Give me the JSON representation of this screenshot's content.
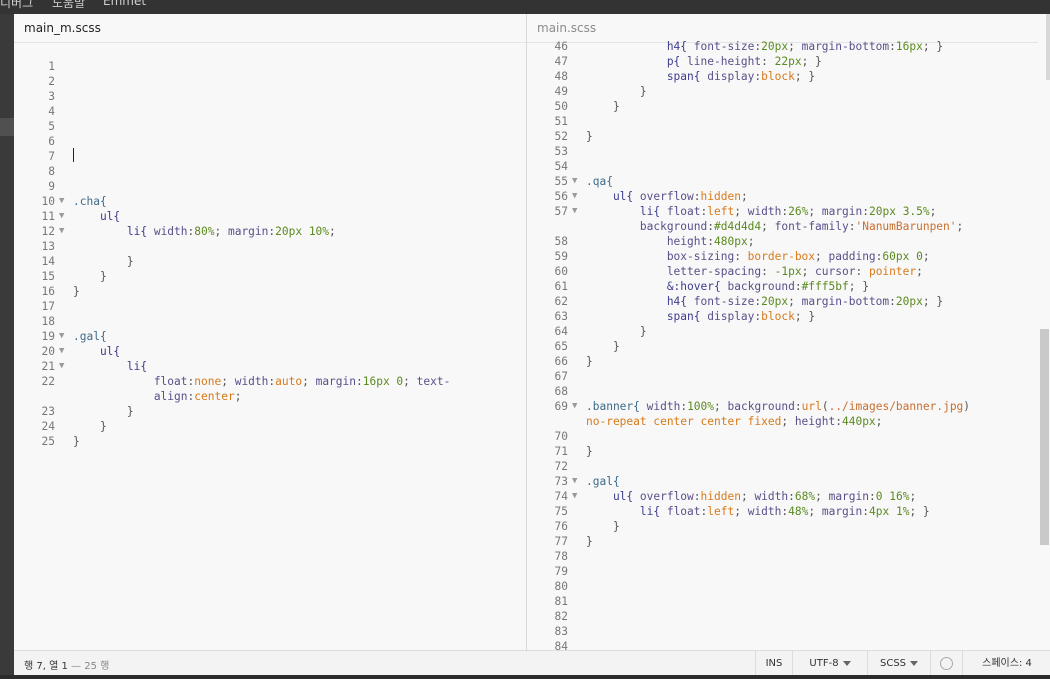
{
  "menu": {
    "items": [
      "디버그",
      "도움말",
      "Emmet"
    ]
  },
  "left_pane": {
    "filename": "main_m.scss",
    "lines": [
      {
        "n": "1",
        "fold": false,
        "tokens": []
      },
      {
        "n": "2",
        "fold": false,
        "tokens": []
      },
      {
        "n": "3",
        "fold": false,
        "tokens": []
      },
      {
        "n": "4",
        "fold": false,
        "tokens": []
      },
      {
        "n": "5",
        "fold": false,
        "tokens": []
      },
      {
        "n": "6",
        "fold": false,
        "tokens": []
      },
      {
        "n": "7",
        "fold": false,
        "tokens": []
      },
      {
        "n": "8",
        "fold": false,
        "tokens": []
      },
      {
        "n": "9",
        "fold": false,
        "tokens": []
      },
      {
        "n": "10",
        "fold": true,
        "tokens": [
          {
            "t": ".cha{",
            "c": "t-sel"
          }
        ]
      },
      {
        "n": "11",
        "fold": true,
        "tokens": [
          {
            "t": "    ul{",
            "c": "t-tag"
          }
        ]
      },
      {
        "n": "12",
        "fold": true,
        "tokens": [
          {
            "t": "        li{ ",
            "c": "t-tag"
          },
          {
            "t": "width",
            "c": "t-prop"
          },
          {
            "t": ":",
            "c": "t-p"
          },
          {
            "t": "80%",
            "c": "t-val"
          },
          {
            "t": "; ",
            "c": "t-p"
          },
          {
            "t": "margin",
            "c": "t-prop"
          },
          {
            "t": ":",
            "c": "t-p"
          },
          {
            "t": "20px 10%",
            "c": "t-val"
          },
          {
            "t": ";",
            "c": "t-p"
          }
        ]
      },
      {
        "n": "13",
        "fold": false,
        "tokens": []
      },
      {
        "n": "14",
        "fold": false,
        "tokens": [
          {
            "t": "        }",
            "c": "t-p"
          }
        ]
      },
      {
        "n": "15",
        "fold": false,
        "tokens": [
          {
            "t": "    }",
            "c": "t-p"
          }
        ]
      },
      {
        "n": "16",
        "fold": false,
        "tokens": [
          {
            "t": "}",
            "c": "t-p"
          }
        ]
      },
      {
        "n": "17",
        "fold": false,
        "tokens": []
      },
      {
        "n": "18",
        "fold": false,
        "tokens": []
      },
      {
        "n": "19",
        "fold": true,
        "tokens": [
          {
            "t": ".gal{",
            "c": "t-sel"
          }
        ]
      },
      {
        "n": "20",
        "fold": true,
        "tokens": [
          {
            "t": "    ul{",
            "c": "t-tag"
          }
        ]
      },
      {
        "n": "21",
        "fold": true,
        "tokens": [
          {
            "t": "        li{",
            "c": "t-tag"
          }
        ]
      },
      {
        "n": "22",
        "fold": false,
        "tokens": [
          {
            "t": "            float",
            "c": "t-prop"
          },
          {
            "t": ":",
            "c": "t-p"
          },
          {
            "t": "none",
            "c": "t-kw"
          },
          {
            "t": "; ",
            "c": "t-p"
          },
          {
            "t": "width",
            "c": "t-prop"
          },
          {
            "t": ":",
            "c": "t-p"
          },
          {
            "t": "auto",
            "c": "t-kw"
          },
          {
            "t": "; ",
            "c": "t-p"
          },
          {
            "t": "margin",
            "c": "t-prop"
          },
          {
            "t": ":",
            "c": "t-p"
          },
          {
            "t": "16px 0",
            "c": "t-val"
          },
          {
            "t": "; ",
            "c": "t-p"
          },
          {
            "t": "text-",
            "c": "t-prop"
          }
        ]
      },
      {
        "n": "",
        "fold": false,
        "tokens": [
          {
            "t": "            align",
            "c": "t-prop"
          },
          {
            "t": ":",
            "c": "t-p"
          },
          {
            "t": "center",
            "c": "t-kw"
          },
          {
            "t": ";",
            "c": "t-p"
          }
        ]
      },
      {
        "n": "23",
        "fold": false,
        "tokens": [
          {
            "t": "        }",
            "c": "t-p"
          }
        ]
      },
      {
        "n": "24",
        "fold": false,
        "tokens": [
          {
            "t": "    }",
            "c": "t-p"
          }
        ]
      },
      {
        "n": "25",
        "fold": false,
        "tokens": [
          {
            "t": "}",
            "c": "t-p"
          }
        ]
      }
    ]
  },
  "right_pane": {
    "filename": "main.scss",
    "lines": [
      {
        "n": "46",
        "fold": false,
        "tokens": [
          {
            "t": "            h4{ ",
            "c": "t-tag"
          },
          {
            "t": "font-size",
            "c": "t-prop"
          },
          {
            "t": ":",
            "c": "t-p"
          },
          {
            "t": "20px",
            "c": "t-val"
          },
          {
            "t": "; ",
            "c": "t-p"
          },
          {
            "t": "margin-bottom",
            "c": "t-prop"
          },
          {
            "t": ":",
            "c": "t-p"
          },
          {
            "t": "16px",
            "c": "t-val"
          },
          {
            "t": "; }",
            "c": "t-p"
          }
        ]
      },
      {
        "n": "47",
        "fold": false,
        "tokens": [
          {
            "t": "            p{ ",
            "c": "t-tag"
          },
          {
            "t": "line-height",
            "c": "t-prop"
          },
          {
            "t": ": ",
            "c": "t-p"
          },
          {
            "t": "22px",
            "c": "t-val"
          },
          {
            "t": "; }",
            "c": "t-p"
          }
        ]
      },
      {
        "n": "48",
        "fold": false,
        "tokens": [
          {
            "t": "            span{ ",
            "c": "t-tag"
          },
          {
            "t": "display",
            "c": "t-prop"
          },
          {
            "t": ":",
            "c": "t-p"
          },
          {
            "t": "block",
            "c": "t-kw"
          },
          {
            "t": "; }",
            "c": "t-p"
          }
        ]
      },
      {
        "n": "49",
        "fold": false,
        "tokens": [
          {
            "t": "        }",
            "c": "t-p"
          }
        ]
      },
      {
        "n": "50",
        "fold": false,
        "tokens": [
          {
            "t": "    }",
            "c": "t-p"
          }
        ]
      },
      {
        "n": "51",
        "fold": false,
        "tokens": []
      },
      {
        "n": "52",
        "fold": false,
        "tokens": [
          {
            "t": "}",
            "c": "t-p"
          }
        ]
      },
      {
        "n": "53",
        "fold": false,
        "tokens": []
      },
      {
        "n": "54",
        "fold": false,
        "tokens": []
      },
      {
        "n": "55",
        "fold": true,
        "tokens": [
          {
            "t": ".qa{",
            "c": "t-sel"
          }
        ]
      },
      {
        "n": "56",
        "fold": true,
        "tokens": [
          {
            "t": "    ul{ ",
            "c": "t-tag"
          },
          {
            "t": "overflow",
            "c": "t-prop"
          },
          {
            "t": ":",
            "c": "t-p"
          },
          {
            "t": "hidden",
            "c": "t-kw"
          },
          {
            "t": ";",
            "c": "t-p"
          }
        ]
      },
      {
        "n": "57",
        "fold": true,
        "tokens": [
          {
            "t": "        li{ ",
            "c": "t-tag"
          },
          {
            "t": "float",
            "c": "t-prop"
          },
          {
            "t": ":",
            "c": "t-p"
          },
          {
            "t": "left",
            "c": "t-kw"
          },
          {
            "t": "; ",
            "c": "t-p"
          },
          {
            "t": "width",
            "c": "t-prop"
          },
          {
            "t": ":",
            "c": "t-p"
          },
          {
            "t": "26%",
            "c": "t-val"
          },
          {
            "t": "; ",
            "c": "t-p"
          },
          {
            "t": "margin",
            "c": "t-prop"
          },
          {
            "t": ":",
            "c": "t-p"
          },
          {
            "t": "20px 3.5%",
            "c": "t-val"
          },
          {
            "t": ";",
            "c": "t-p"
          }
        ]
      },
      {
        "n": "",
        "fold": false,
        "tokens": [
          {
            "t": "        background",
            "c": "t-prop"
          },
          {
            "t": ":",
            "c": "t-p"
          },
          {
            "t": "#d4d4d4",
            "c": "t-val"
          },
          {
            "t": "; ",
            "c": "t-p"
          },
          {
            "t": "font-family",
            "c": "t-prop"
          },
          {
            "t": ":",
            "c": "t-p"
          },
          {
            "t": "'NanumBarunpen'",
            "c": "t-str"
          },
          {
            "t": ";",
            "c": "t-p"
          }
        ]
      },
      {
        "n": "58",
        "fold": false,
        "tokens": [
          {
            "t": "            height",
            "c": "t-prop"
          },
          {
            "t": ":",
            "c": "t-p"
          },
          {
            "t": "480px",
            "c": "t-val"
          },
          {
            "t": ";",
            "c": "t-p"
          }
        ]
      },
      {
        "n": "59",
        "fold": false,
        "tokens": [
          {
            "t": "            box-sizing",
            "c": "t-prop"
          },
          {
            "t": ": ",
            "c": "t-p"
          },
          {
            "t": "border-box",
            "c": "t-kw"
          },
          {
            "t": "; ",
            "c": "t-p"
          },
          {
            "t": "padding",
            "c": "t-prop"
          },
          {
            "t": ":",
            "c": "t-p"
          },
          {
            "t": "60px 0",
            "c": "t-val"
          },
          {
            "t": ";",
            "c": "t-p"
          }
        ]
      },
      {
        "n": "60",
        "fold": false,
        "tokens": [
          {
            "t": "            letter-spacing",
            "c": "t-prop"
          },
          {
            "t": ": ",
            "c": "t-p"
          },
          {
            "t": "-1px",
            "c": "t-val"
          },
          {
            "t": "; ",
            "c": "t-p"
          },
          {
            "t": "cursor",
            "c": "t-prop"
          },
          {
            "t": ": ",
            "c": "t-p"
          },
          {
            "t": "pointer",
            "c": "t-kw"
          },
          {
            "t": ";",
            "c": "t-p"
          }
        ]
      },
      {
        "n": "61",
        "fold": false,
        "tokens": [
          {
            "t": "            &:hover{ ",
            "c": "t-tag"
          },
          {
            "t": "background",
            "c": "t-prop"
          },
          {
            "t": ":",
            "c": "t-p"
          },
          {
            "t": "#fff5bf",
            "c": "t-val"
          },
          {
            "t": "; }",
            "c": "t-p"
          }
        ]
      },
      {
        "n": "62",
        "fold": false,
        "tokens": [
          {
            "t": "            h4{ ",
            "c": "t-tag"
          },
          {
            "t": "font-size",
            "c": "t-prop"
          },
          {
            "t": ":",
            "c": "t-p"
          },
          {
            "t": "20px",
            "c": "t-val"
          },
          {
            "t": "; ",
            "c": "t-p"
          },
          {
            "t": "margin-bottom",
            "c": "t-prop"
          },
          {
            "t": ":",
            "c": "t-p"
          },
          {
            "t": "20px",
            "c": "t-val"
          },
          {
            "t": "; }",
            "c": "t-p"
          }
        ]
      },
      {
        "n": "63",
        "fold": false,
        "tokens": [
          {
            "t": "            span{ ",
            "c": "t-tag"
          },
          {
            "t": "display",
            "c": "t-prop"
          },
          {
            "t": ":",
            "c": "t-p"
          },
          {
            "t": "block",
            "c": "t-kw"
          },
          {
            "t": "; }",
            "c": "t-p"
          }
        ]
      },
      {
        "n": "64",
        "fold": false,
        "tokens": [
          {
            "t": "        }",
            "c": "t-p"
          }
        ]
      },
      {
        "n": "65",
        "fold": false,
        "tokens": [
          {
            "t": "    }",
            "c": "t-p"
          }
        ]
      },
      {
        "n": "66",
        "fold": false,
        "tokens": [
          {
            "t": "}",
            "c": "t-p"
          }
        ]
      },
      {
        "n": "67",
        "fold": false,
        "tokens": []
      },
      {
        "n": "68",
        "fold": false,
        "tokens": []
      },
      {
        "n": "69",
        "fold": true,
        "tokens": [
          {
            "t": ".banner{ ",
            "c": "t-sel"
          },
          {
            "t": "width",
            "c": "t-prop"
          },
          {
            "t": ":",
            "c": "t-p"
          },
          {
            "t": "100%",
            "c": "t-val"
          },
          {
            "t": "; ",
            "c": "t-p"
          },
          {
            "t": "background",
            "c": "t-prop"
          },
          {
            "t": ":",
            "c": "t-p"
          },
          {
            "t": "url",
            "c": "t-kw"
          },
          {
            "t": "(",
            "c": "t-p"
          },
          {
            "t": "../images/banner.jpg",
            "c": "t-str"
          },
          {
            "t": ")",
            "c": "t-p"
          }
        ]
      },
      {
        "n": "",
        "fold": false,
        "tokens": [
          {
            "t": "no-repeat center center fixed",
            "c": "t-kw"
          },
          {
            "t": "; ",
            "c": "t-p"
          },
          {
            "t": "height",
            "c": "t-prop"
          },
          {
            "t": ":",
            "c": "t-p"
          },
          {
            "t": "440px",
            "c": "t-val"
          },
          {
            "t": ";",
            "c": "t-p"
          }
        ]
      },
      {
        "n": "70",
        "fold": false,
        "tokens": []
      },
      {
        "n": "71",
        "fold": false,
        "tokens": [
          {
            "t": "}",
            "c": "t-p"
          }
        ]
      },
      {
        "n": "72",
        "fold": false,
        "tokens": []
      },
      {
        "n": "73",
        "fold": true,
        "tokens": [
          {
            "t": ".gal{",
            "c": "t-sel"
          }
        ]
      },
      {
        "n": "74",
        "fold": true,
        "tokens": [
          {
            "t": "    ul{ ",
            "c": "t-tag"
          },
          {
            "t": "overflow",
            "c": "t-prop"
          },
          {
            "t": ":",
            "c": "t-p"
          },
          {
            "t": "hidden",
            "c": "t-kw"
          },
          {
            "t": "; ",
            "c": "t-p"
          },
          {
            "t": "width",
            "c": "t-prop"
          },
          {
            "t": ":",
            "c": "t-p"
          },
          {
            "t": "68%",
            "c": "t-val"
          },
          {
            "t": "; ",
            "c": "t-p"
          },
          {
            "t": "margin",
            "c": "t-prop"
          },
          {
            "t": ":",
            "c": "t-p"
          },
          {
            "t": "0 16%",
            "c": "t-val"
          },
          {
            "t": ";",
            "c": "t-p"
          }
        ]
      },
      {
        "n": "75",
        "fold": false,
        "tokens": [
          {
            "t": "        li{ ",
            "c": "t-tag"
          },
          {
            "t": "float",
            "c": "t-prop"
          },
          {
            "t": ":",
            "c": "t-p"
          },
          {
            "t": "left",
            "c": "t-kw"
          },
          {
            "t": "; ",
            "c": "t-p"
          },
          {
            "t": "width",
            "c": "t-prop"
          },
          {
            "t": ":",
            "c": "t-p"
          },
          {
            "t": "48%",
            "c": "t-val"
          },
          {
            "t": "; ",
            "c": "t-p"
          },
          {
            "t": "margin",
            "c": "t-prop"
          },
          {
            "t": ":",
            "c": "t-p"
          },
          {
            "t": "4px 1%",
            "c": "t-val"
          },
          {
            "t": "; }",
            "c": "t-p"
          }
        ]
      },
      {
        "n": "76",
        "fold": false,
        "tokens": [
          {
            "t": "    }",
            "c": "t-p"
          }
        ]
      },
      {
        "n": "77",
        "fold": false,
        "tokens": [
          {
            "t": "}",
            "c": "t-p"
          }
        ]
      },
      {
        "n": "78",
        "fold": false,
        "tokens": []
      },
      {
        "n": "79",
        "fold": false,
        "tokens": []
      },
      {
        "n": "80",
        "fold": false,
        "tokens": []
      },
      {
        "n": "81",
        "fold": false,
        "tokens": []
      },
      {
        "n": "82",
        "fold": false,
        "tokens": []
      },
      {
        "n": "83",
        "fold": false,
        "tokens": []
      },
      {
        "n": "84",
        "fold": false,
        "tokens": []
      }
    ]
  },
  "status": {
    "position": "행 7, 열 1",
    "line_count": " — 25 행",
    "insert_mode": "INS",
    "encoding": "UTF-8",
    "language": "SCSS",
    "linter_icon": "circle-icon",
    "indent": "스페이스: 4"
  },
  "colors": {
    "selector": "#3e6b8a",
    "property": "#5a4f8a",
    "value": "#5b8a1f",
    "keyword": "#d77a1a",
    "string": "#c86f2f"
  }
}
